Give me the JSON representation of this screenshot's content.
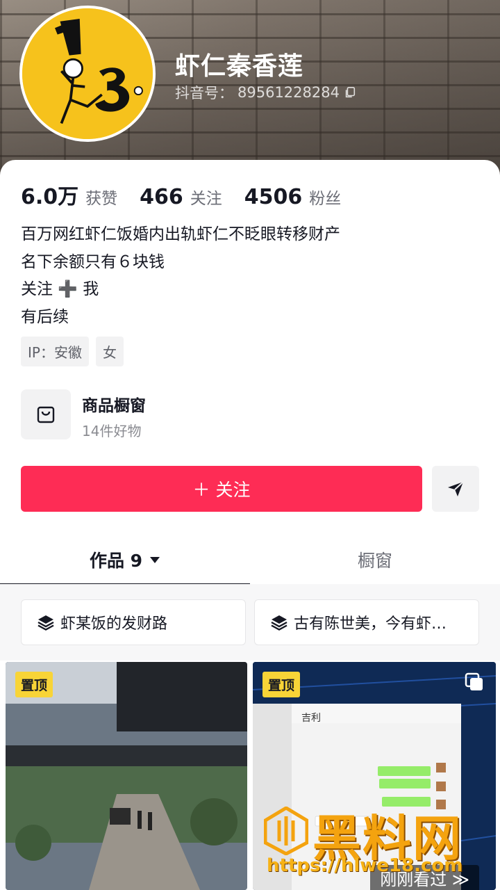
{
  "profile": {
    "name": "虾仁秦香莲",
    "douyin_id_label": "抖音号：",
    "douyin_id": "89561228284"
  },
  "stats": [
    {
      "num": "6.0万",
      "label": "获赞"
    },
    {
      "num": "466",
      "label": "关注"
    },
    {
      "num": "4506",
      "label": "粉丝"
    }
  ],
  "bio": [
    "百万网红虾仁饭婚内出轨虾仁不眨眼转移财产",
    "名下余额只有６块钱",
    "关注 ➕ 我",
    "有后续"
  ],
  "tags": [
    "IP：安徽",
    "女"
  ],
  "shop": {
    "title": "商品橱窗",
    "subtitle": "14件好物",
    "icon": "shopping-bag-icon"
  },
  "actions": {
    "follow_label": "＋ 关注",
    "share_icon": "paper-plane-icon"
  },
  "tabs": {
    "works_label": "作品 9",
    "works_dropdown_icon": "caret-down-icon",
    "window_label": "橱窗"
  },
  "collections": [
    {
      "label": "虾某饭的发财路",
      "icon": "stack-icon"
    },
    {
      "label": "古有陈世美，今有虾…",
      "icon": "stack-icon"
    }
  ],
  "videos": [
    {
      "pin_label": "置顶"
    },
    {
      "pin_label": "置顶",
      "chat_title": "吉利",
      "recent_label": "刚刚看过 ≫"
    }
  ],
  "watermark": {
    "title": "黑料网",
    "url": "https://hlwe18.com"
  },
  "colors": {
    "accent": "#fe2c55",
    "pin": "#f8d437",
    "avatar_bg": "#f6c21c"
  }
}
